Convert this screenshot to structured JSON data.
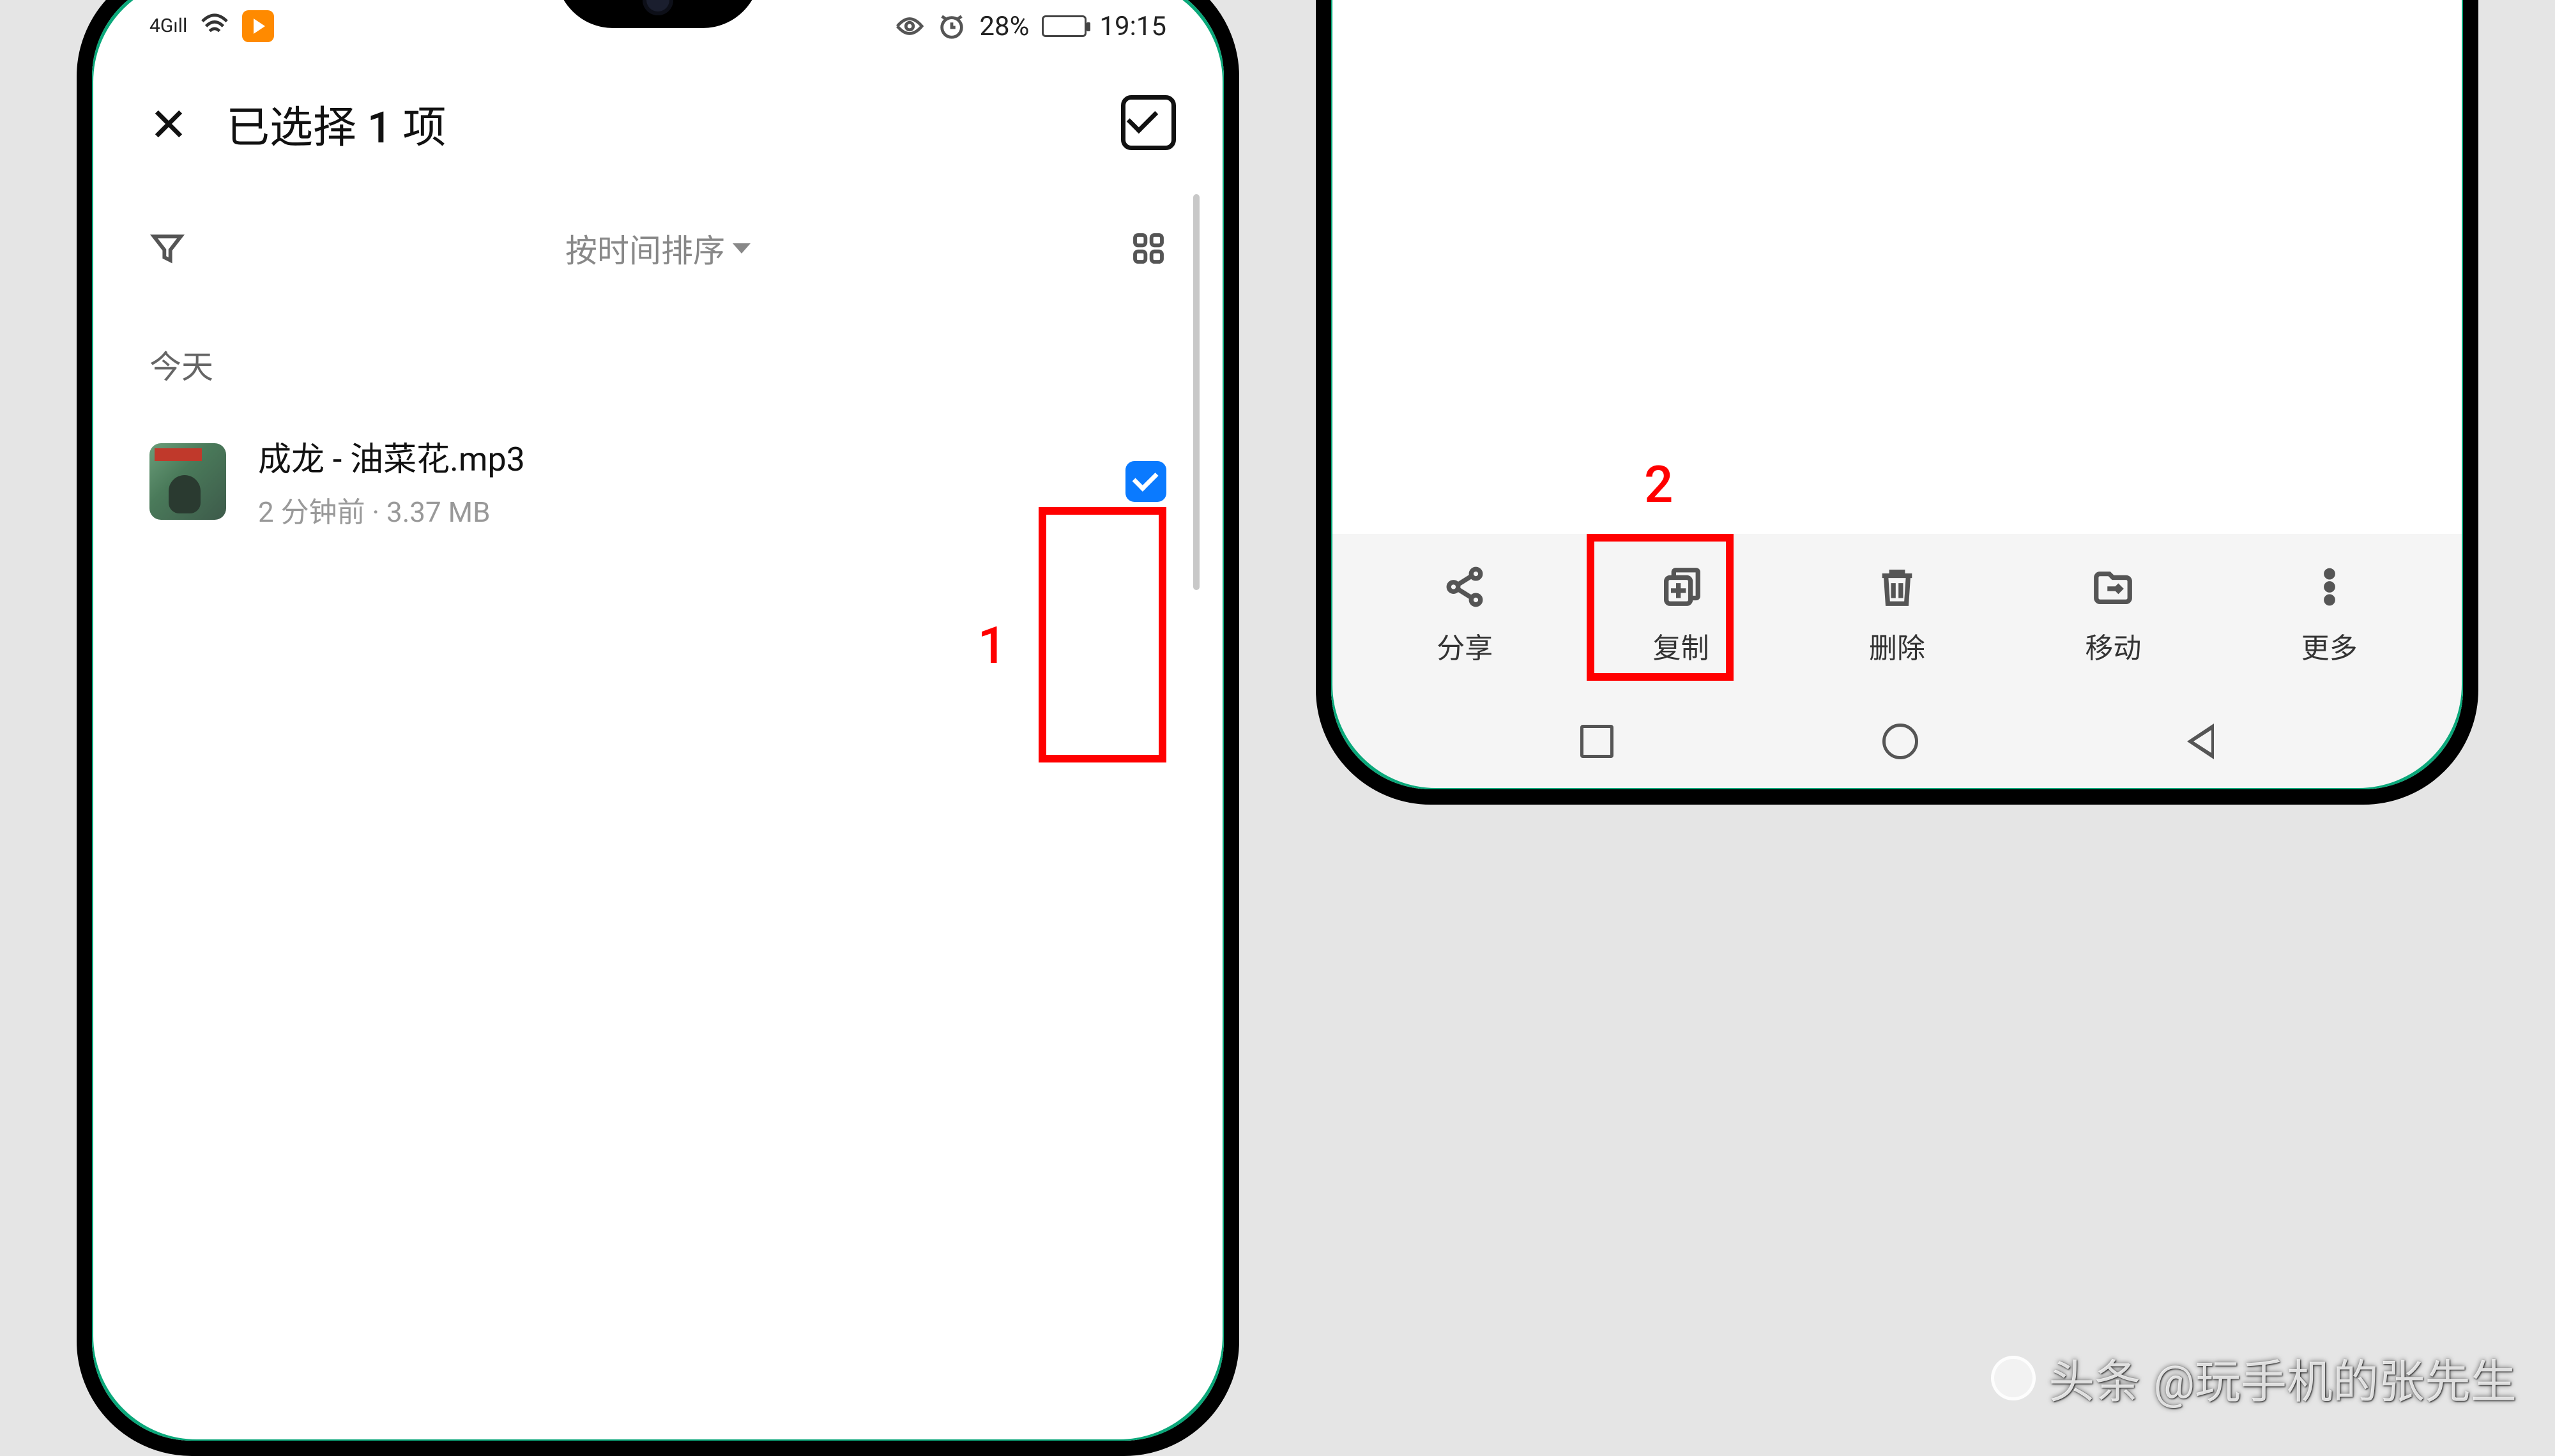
{
  "status": {
    "signal": "4G",
    "battery_pct": "28%",
    "time": "19:15"
  },
  "header": {
    "title": "已选择 1 项"
  },
  "sort": {
    "label": "按时间排序"
  },
  "section": {
    "today": "今天"
  },
  "file": {
    "name": "成龙 - 油菜花.mp3",
    "meta": "2 分钟前 · 3.37 MB",
    "checked": true
  },
  "annotations": {
    "n1": "1",
    "n2": "2"
  },
  "toolbar": {
    "share": "分享",
    "copy": "复制",
    "delete": "删除",
    "move": "移动",
    "more": "更多"
  },
  "watermark": {
    "brand": "头条",
    "author": "@玩手机的张先生"
  }
}
